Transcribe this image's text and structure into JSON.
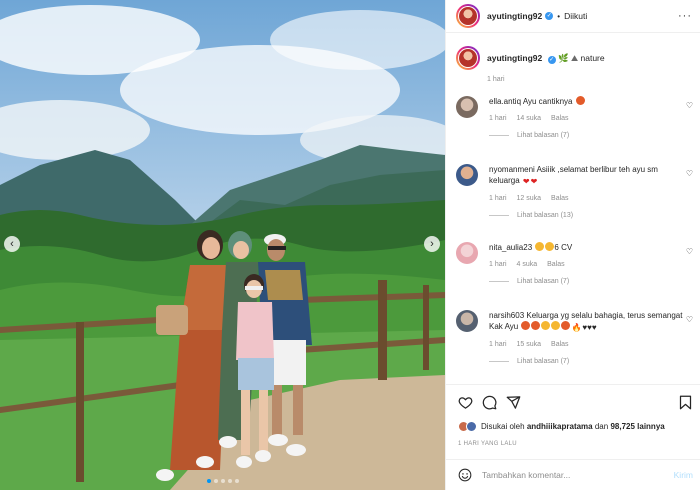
{
  "post": {
    "username": "ayutingting92",
    "follow_label": "Diikuti",
    "caption_suffix": "nature",
    "caption_time": "1 hari",
    "separator": "•"
  },
  "comments": [
    {
      "username": "ella.antiq",
      "text": "Ayu cantiknya",
      "time": "1 hari",
      "likes": "14 suka",
      "reply": "Balas",
      "view_replies": "Lihat balasan (7)"
    },
    {
      "username": "nyomanmeni",
      "text": "Asiiik ,selamat berlibur teh ayu sm keluarga",
      "time": "1 hari",
      "likes": "12 suka",
      "reply": "Balas",
      "view_replies": "Lihat balasan (13)"
    },
    {
      "username": "nita_aulia23",
      "text": "6 CV",
      "time": "1 hari",
      "likes": "4 suka",
      "reply": "Balas",
      "view_replies": "Lihat balasan (7)"
    },
    {
      "username": "narsih603",
      "text": "Keluarga yg selalu bahagia, terus semangat Kak Ayu",
      "time": "1 hari",
      "likes": "15 suka",
      "reply": "Balas",
      "view_replies": "Lihat balasan (7)"
    }
  ],
  "likes": {
    "prefix": "Disukai oleh",
    "user": "andhiiikapratama",
    "conj": "dan",
    "count": "98,725 lainnya"
  },
  "post_time": "1 HARI YANG LALU",
  "add_comment": {
    "placeholder": "Tambahkan komentar...",
    "post_label": "Kirim"
  },
  "colors": {
    "verified": "#3897f0",
    "link": "#0095f6",
    "post_disabled": "#b2dffc",
    "muted": "#8e8e8e"
  },
  "icons": [
    "chevron-left-icon",
    "chevron-right-icon",
    "more-icon",
    "verified-icon",
    "heart-icon",
    "comment-icon",
    "share-icon",
    "bookmark-icon",
    "emoji-icon"
  ]
}
